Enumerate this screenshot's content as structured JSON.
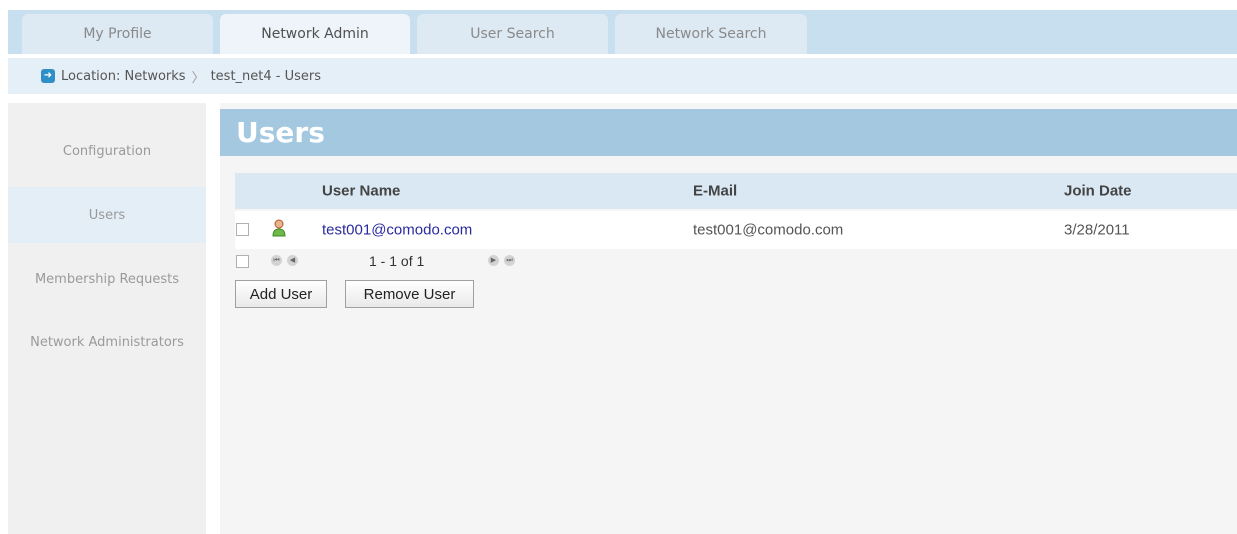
{
  "tabs": [
    {
      "label": "My Profile"
    },
    {
      "label": "Network Admin"
    },
    {
      "label": "User Search"
    },
    {
      "label": "Network Search"
    }
  ],
  "breadcrumb": {
    "location_label": "Location: Networks",
    "separator": "〉",
    "current": "test_net4 - Users"
  },
  "sidebar": {
    "items": [
      {
        "label": "Configuration"
      },
      {
        "label": "Users"
      },
      {
        "label": "Membership Requests"
      },
      {
        "label": "Network Administrators"
      }
    ]
  },
  "main": {
    "title": "Users",
    "table": {
      "columns": [
        "User Name",
        "E-Mail",
        "Join Date"
      ],
      "rows": [
        {
          "user_name": "test001@comodo.com",
          "email": "test001@comodo.com",
          "join_date": "3/28/2011"
        }
      ]
    },
    "pager": {
      "text": "1 - 1 of 1"
    },
    "buttons": {
      "add_user": "Add User",
      "remove_user": "Remove User"
    }
  },
  "icons": {
    "breadcrumb": "arrow-right-icon",
    "user": "user-icon",
    "pager_first": "first-page-icon",
    "pager_prev": "prev-page-icon",
    "pager_next": "next-page-icon",
    "pager_last": "last-page-icon"
  },
  "colors": {
    "tab_bar": "#c8dff0",
    "heading_bg": "#a4c8e0",
    "link": "#2a2aa0"
  }
}
